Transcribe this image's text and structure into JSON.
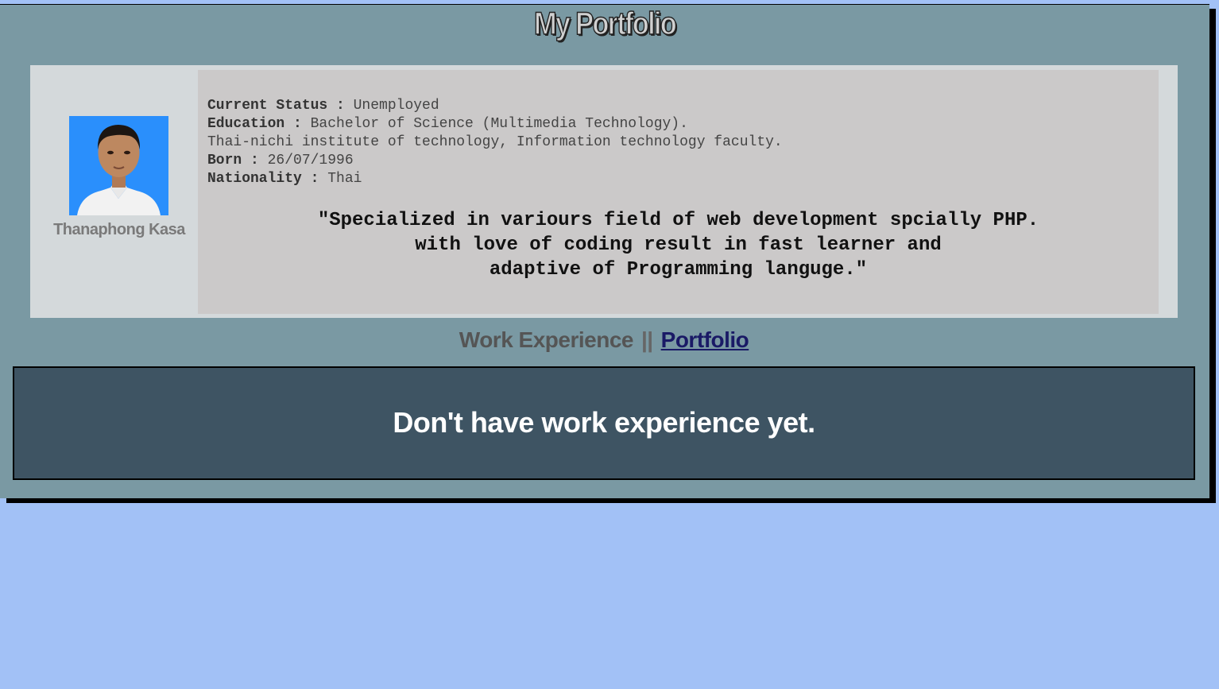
{
  "header": {
    "title": "My Portfolio"
  },
  "profile": {
    "name": "Thanaphong Kasa",
    "avatar_icon": "person-photo",
    "fields": [
      {
        "label": "Current Status :",
        "value": " Unemployed"
      },
      {
        "label": "Education :",
        "value": " Bachelor of Science (Multimedia Technology)."
      },
      {
        "label": "",
        "value": "Thai-nichi institute of technology, Information technology faculty."
      },
      {
        "label": "Born :",
        "value": " 26/07/1996"
      },
      {
        "label": "Nationality :",
        "value": " Thai"
      }
    ],
    "quote_lines": [
      "\"Specialized in variours field of web development spcially PHP.",
      "with love of coding result in fast learner and",
      "adaptive of Programming languge.\""
    ]
  },
  "nav": {
    "work_label": "Work Experience",
    "separator": "||",
    "portfolio_label": "Portfolio"
  },
  "experience": {
    "message": "Don't have work experience yet."
  },
  "colors": {
    "page_bg": "#a2c1f6",
    "frame_bg": "#7a99a3",
    "card_bg": "#d4d9db",
    "panel_bg": "#cbc9c9",
    "experience_bg": "#3e5463",
    "link": "#1a1a66"
  }
}
